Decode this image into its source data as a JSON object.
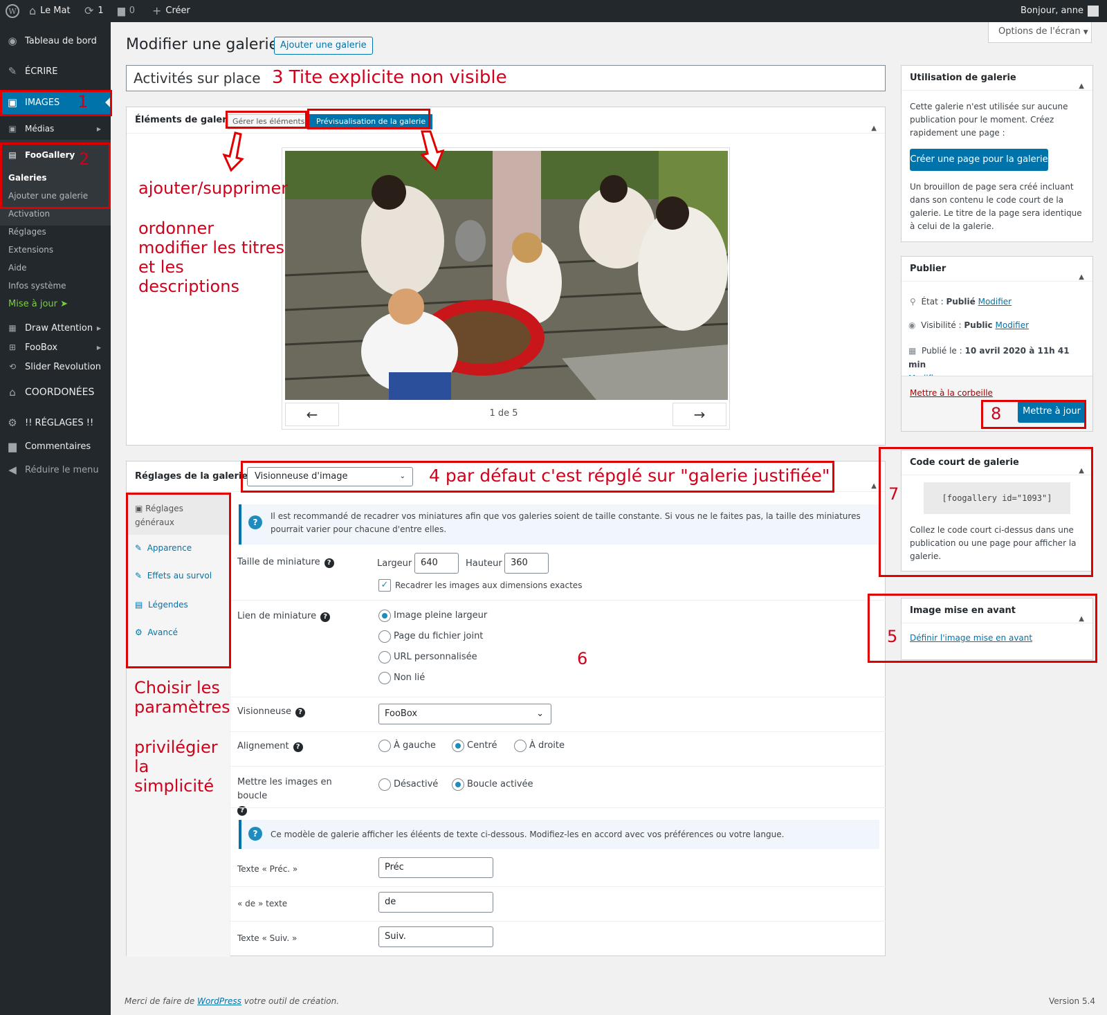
{
  "adminbar": {
    "site": "Le Mat",
    "updates": "1",
    "comments": "0",
    "create": "Créer",
    "greeting": "Bonjour, anne"
  },
  "sidebar": {
    "dashboard": "Tableau de bord",
    "write": "ÉCRIRE",
    "images": "IMAGES",
    "medias": "Médias",
    "foogallery": "FooGallery",
    "galleries": "Galeries",
    "add_gallery": "Ajouter une galerie",
    "activation": "Activation",
    "settings": "Réglages",
    "extensions": "Extensions",
    "help": "Aide",
    "sysinfo": "Infos système",
    "update": "Mise à jour",
    "draw": "Draw Attention",
    "foobox": "FooBox",
    "slider": "Slider Revolution",
    "coords": "COORDONÉES",
    "reglages": "!! RÉGLAGES !!",
    "comments": "Commentaires",
    "collapse": "Réduire le menu"
  },
  "page": {
    "title": "Modifier une galerie",
    "add_button": "Ajouter une galerie",
    "screen_options": "Options de l'écran",
    "gallery_title": "Activités sur place"
  },
  "elements": {
    "heading": "Éléments de galerie",
    "tab_manage": "Gérer les éléments",
    "tab_preview": "Prévisualisation de la galerie",
    "prev": "←",
    "next": "→",
    "counter": "1 de 5"
  },
  "settings": {
    "heading": "Réglages de la galerie",
    "template": "Visionneuse d'image",
    "tabs": [
      "Réglages généraux",
      "Apparence",
      "Effets au survol",
      "Légendes",
      "Avancé"
    ],
    "notice": "Il est recommandé de recadrer vos miniatures afin que vos galeries soient de taille constante. Si vous ne le faites pas, la taille des miniatures pourrait varier pour chacune d'entre elles.",
    "thumb_size": "Taille de miniature",
    "width_label": "Largeur",
    "width": "640",
    "height_label": "Hauteur",
    "height": "360",
    "crop": "Recadrer les images aux dimensions exactes",
    "thumb_link": "Lien de miniature",
    "link_options": [
      "Image pleine largeur",
      "Page du fichier joint",
      "URL personnalisée",
      "Non lié"
    ],
    "viewer": "Visionneuse",
    "viewer_value": "FooBox",
    "align": "Alignement",
    "align_options": [
      "À gauche",
      "Centré",
      "À droite"
    ],
    "loop": "Mettre les images en boucle",
    "loop_options": [
      "Désactivé",
      "Boucle activée"
    ],
    "notice2": "Ce modèle de galerie afficher les éléents de texte ci-dessous. Modifiez-les en accord avec vos préférences ou votre langue.",
    "prev_text_label": "Texte « Préc. »",
    "prev_text": "Préc",
    "of_text_label": "« de » texte",
    "of_text": "de",
    "next_text_label": "Texte « Suiv. »",
    "next_text": "Suiv."
  },
  "usage": {
    "heading": "Utilisation de galerie",
    "text": "Cette galerie n'est utilisée sur aucune publication pour le moment. Créez rapidement une page :",
    "button": "Créer une page pour la galerie",
    "note": "Un brouillon de page sera créé incluant dans son contenu le code court de la galerie. Le titre de la page sera identique à celui de la galerie."
  },
  "publish": {
    "heading": "Publier",
    "state_label": "État :",
    "state": "Publié",
    "visibility_label": "Visibilité :",
    "visibility": "Public",
    "published_label": "Publié le :",
    "published": "10 avril 2020 à 11h 41 min",
    "modify": "Modifier",
    "trash": "Mettre à la corbeille",
    "update": "Mettre à jour"
  },
  "shortcode": {
    "heading": "Code court de galerie",
    "code": "[foogallery id=\"1093\"]",
    "note": "Collez le code court ci-dessus dans une publication ou une page pour afficher la galerie."
  },
  "featured": {
    "heading": "Image mise en avant",
    "link": "Définir l'image mise en avant"
  },
  "footer": {
    "thanks_pre": "Merci de faire de ",
    "wordpress": "WordPress",
    "thanks_post": " votre outil de création.",
    "version": "Version 5.4"
  },
  "annotations": {
    "n1": "1",
    "n2": "2",
    "n3": "3 Tite explicite non visible",
    "n4": "4 par défaut c'est répglé sur \"galerie justifiée\"",
    "n5": "5",
    "n6": "6",
    "n7": "7",
    "n8": "8",
    "add_remove": "ajouter/supprimer",
    "order": "ordonner",
    "edit_titles": "modifier les titres",
    "and_the": "et les",
    "descriptions": "descriptions",
    "choose": "Choisir les",
    "params": "paramètres",
    "prefer": "privilégier",
    "la": "la",
    "simplicity": "simplicité"
  },
  "colors": {
    "accent": "#0073aa",
    "admin_dark": "#23282d",
    "annotation_red": "#e00000"
  }
}
